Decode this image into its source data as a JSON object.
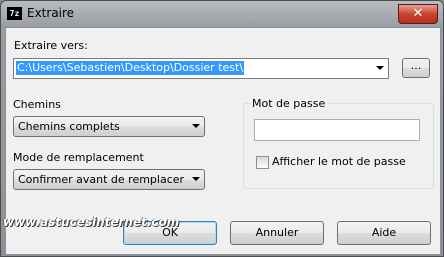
{
  "window": {
    "title": "Extraire",
    "icon_text": "7z",
    "close_symbol": "✕"
  },
  "extract_to": {
    "label": "Extraire vers:",
    "path_value": "C:\\Users\\Sebastien\\Desktop\\Dossier test\\",
    "browse_label": "..."
  },
  "paths": {
    "label": "Chemins",
    "selected": "Chemins complets"
  },
  "overwrite": {
    "label": "Mode de remplacement",
    "selected": "Confirmer avant de remplacer"
  },
  "password": {
    "group_title": "Mot de passe",
    "value": "",
    "show_label": "Afficher le mot de passe",
    "show_checked": false
  },
  "buttons": {
    "ok": "OK",
    "cancel": "Annuler",
    "help": "Aide"
  },
  "watermark": "www.astucesinternet.com"
}
